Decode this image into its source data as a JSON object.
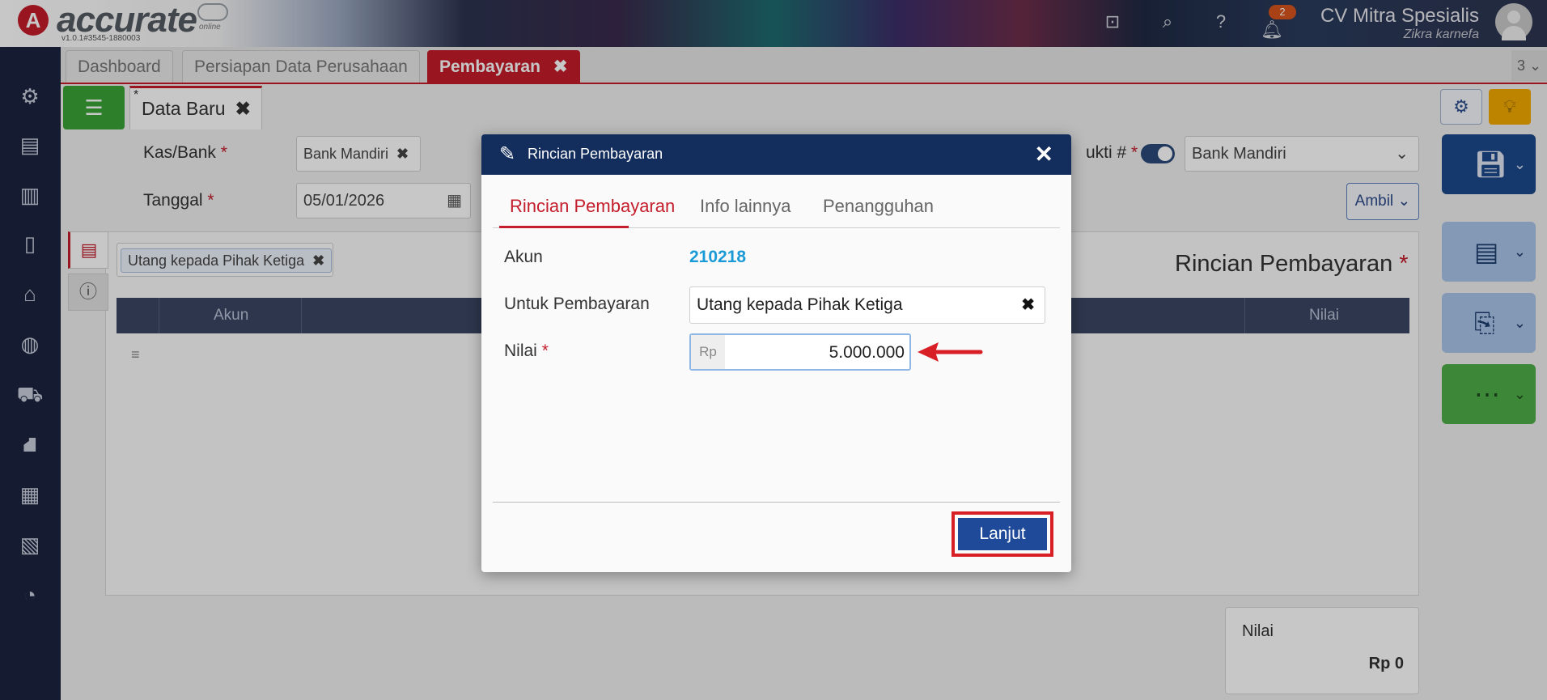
{
  "app": {
    "logo_text": "accurate",
    "logo_sub": "online",
    "version": "v1.0.1#3545-1880003",
    "notification_count": "2",
    "company_name": "CV Mitra Spesialis",
    "user_name": "Zikra karnefa"
  },
  "tabs": {
    "dashboard": "Dashboard",
    "persiapan": "Persiapan Data Perusahaan",
    "pembayaran": "Pembayaran",
    "close": "✖",
    "count": "3 ⌄"
  },
  "doc_tab": {
    "label": "Data Baru",
    "modified_mark": "*",
    "close": "✖"
  },
  "form": {
    "kas_bank_label": "Kas/Bank",
    "kas_bank_value": "Bank Mandiri",
    "tanggal_label": "Tanggal",
    "tanggal_value": "05/01/2026",
    "bukti_label": "ukti #",
    "bank_select_value": "Bank Mandiri",
    "ambil_label": "Ambil ⌄",
    "required_mark": "*"
  },
  "detail": {
    "account_chip": "Utang kepada Pihak Ketiga",
    "title": "Rincian Pembayaran",
    "columns": [
      "Akun",
      "Nilai"
    ]
  },
  "summary": {
    "label": "Nilai",
    "value": "Rp 0"
  },
  "modal": {
    "title": "Rincian Pembayaran",
    "close": "✕",
    "tabs": [
      "Rincian Pembayaran",
      "Info lainnya",
      "Penangguhan"
    ],
    "akun_label": "Akun",
    "akun_value": "210218",
    "untuk_label": "Untuk Pembayaran",
    "untuk_value": "Utang kepada Pihak Ketiga",
    "nilai_label": "Nilai",
    "nilai_prefix": "Rp",
    "nilai_value": "5.000.000",
    "lanjut_label": "Lanjut"
  },
  "colors": {
    "accent_red": "#c41d2b",
    "modal_header": "#132e5c",
    "primary_button": "#1f4a9a",
    "link_blue": "#1a9ad6"
  }
}
